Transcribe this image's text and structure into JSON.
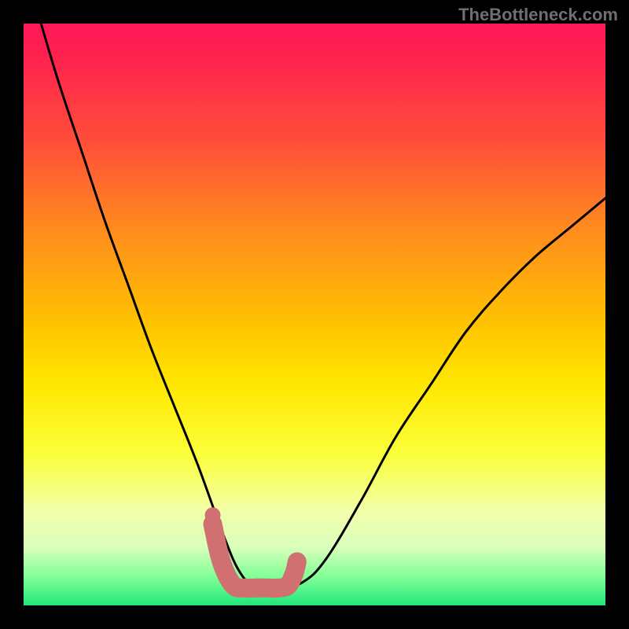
{
  "watermark": "TheBottleneck.com",
  "chart_data": {
    "type": "line",
    "title": "",
    "xlabel": "",
    "ylabel": "",
    "xlim": [
      0,
      1
    ],
    "ylim": [
      0,
      1
    ],
    "series": [
      {
        "name": "bottleneck-curve",
        "x": [
          0.03,
          0.06,
          0.1,
          0.14,
          0.18,
          0.22,
          0.26,
          0.3,
          0.34,
          0.37,
          0.4,
          0.44,
          0.48,
          0.52,
          0.58,
          0.64,
          0.7,
          0.76,
          0.82,
          0.88,
          0.94,
          1.0
        ],
        "values": [
          1.0,
          0.9,
          0.78,
          0.66,
          0.55,
          0.44,
          0.34,
          0.24,
          0.13,
          0.06,
          0.03,
          0.03,
          0.04,
          0.08,
          0.18,
          0.29,
          0.38,
          0.47,
          0.54,
          0.6,
          0.65,
          0.7
        ]
      }
    ],
    "highlight": {
      "name": "min-region-marker",
      "x": [
        0.325,
        0.34,
        0.36,
        0.38,
        0.4,
        0.42,
        0.44,
        0.455,
        0.465,
        0.47
      ],
      "values": [
        0.14,
        0.075,
        0.035,
        0.03,
        0.03,
        0.03,
        0.03,
        0.035,
        0.055,
        0.075
      ],
      "color": "#d07070",
      "stroke_width": 24
    },
    "dots": [
      {
        "x": 0.325,
        "y": 0.155,
        "r": 10,
        "color": "#d07070"
      }
    ]
  }
}
